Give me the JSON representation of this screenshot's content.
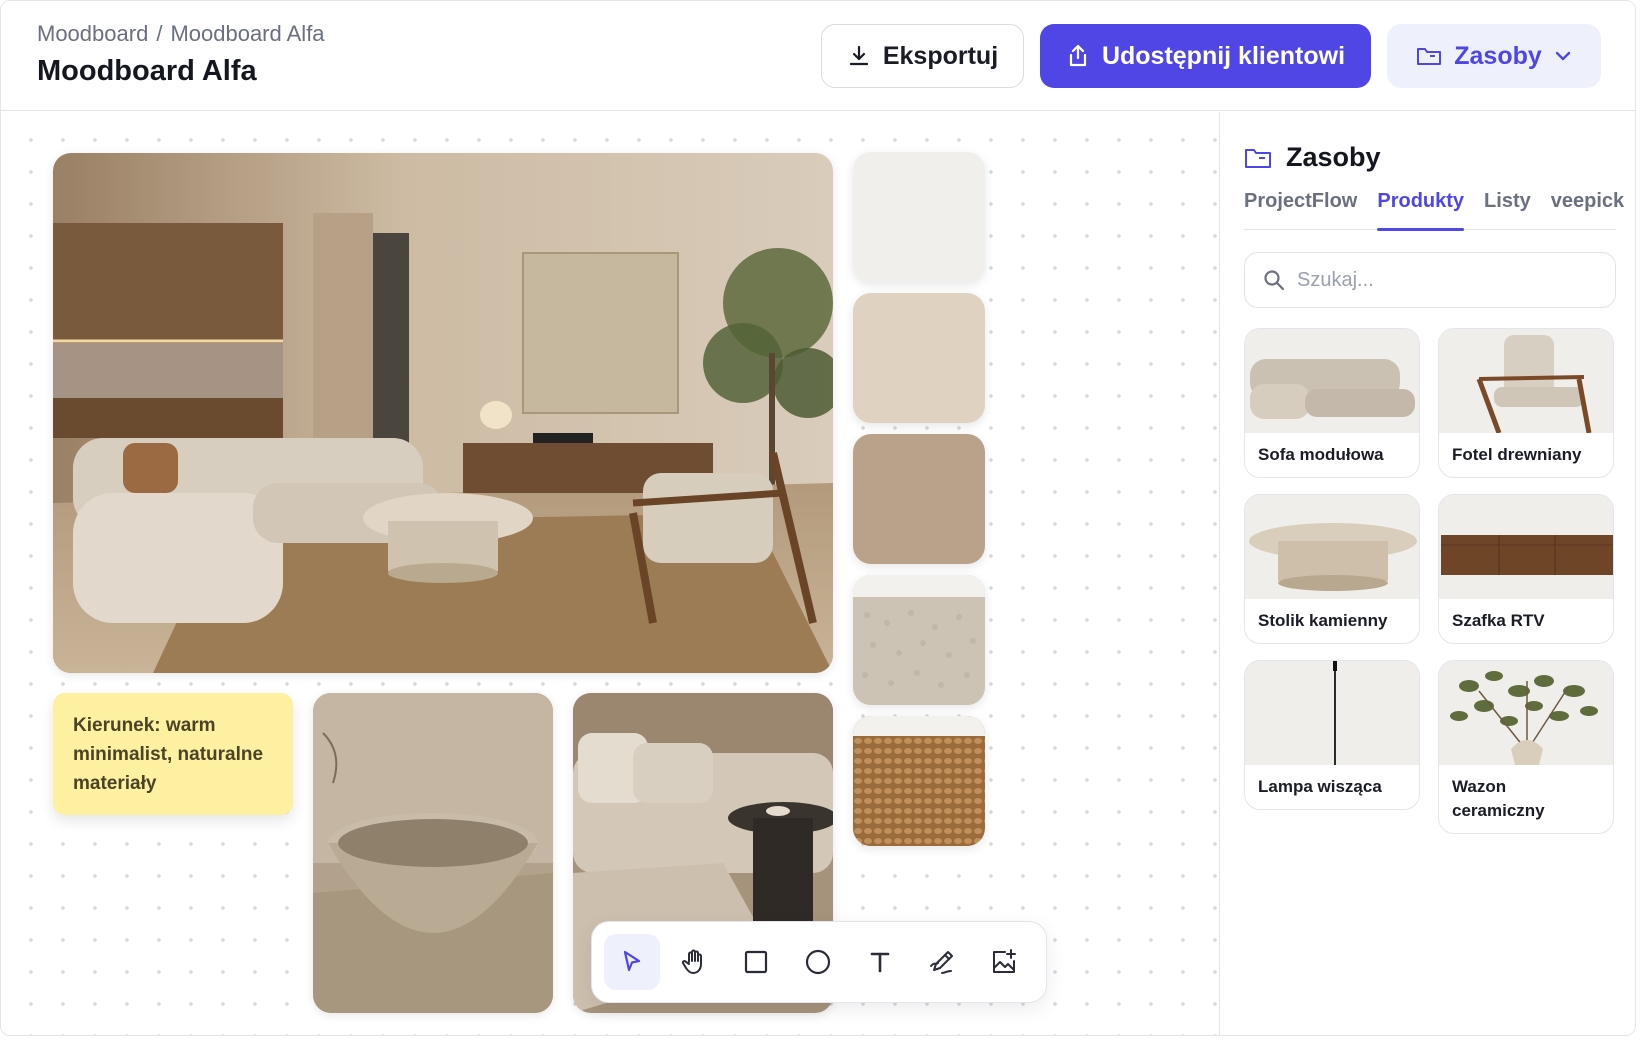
{
  "header": {
    "breadcrumb": [
      "Moodboard",
      "/",
      "Moodboard Alfa"
    ],
    "title": "Moodboard Alfa",
    "export_label": "Eksportuj",
    "share_label": "Udostępnij klientowi",
    "assets_label": "Zasoby"
  },
  "colors": {
    "accent": "#4f46e5",
    "note_bg": "#fdf0a1",
    "swatches": [
      "#f1efeb",
      "#e0d2c0",
      "#baa18a"
    ]
  },
  "canvas": {
    "note_text": "Kierunek: warm minimalist, naturalne materiały",
    "swatch_kinds": [
      "color",
      "color",
      "color",
      "fabric-boucle",
      "fabric-woven"
    ]
  },
  "toolbar": {
    "tools": [
      "pointer-icon",
      "hand-icon",
      "rectangle-icon",
      "circle-icon",
      "text-icon",
      "pen-icon",
      "image-add-icon"
    ],
    "active": "pointer-icon"
  },
  "panel": {
    "title": "Zasoby",
    "tabs": [
      "ProjectFlow",
      "Produkty",
      "Listy",
      "veepick"
    ],
    "active_tab": "Produkty",
    "search_placeholder": "Szukaj...",
    "products": [
      {
        "name": "Sofa modułowa"
      },
      {
        "name": "Fotel drewniany"
      },
      {
        "name": "Stolik kamienny"
      },
      {
        "name": "Szafka RTV"
      },
      {
        "name": "Lampa wisząca"
      },
      {
        "name": "Wazon ceramiczny"
      }
    ]
  }
}
